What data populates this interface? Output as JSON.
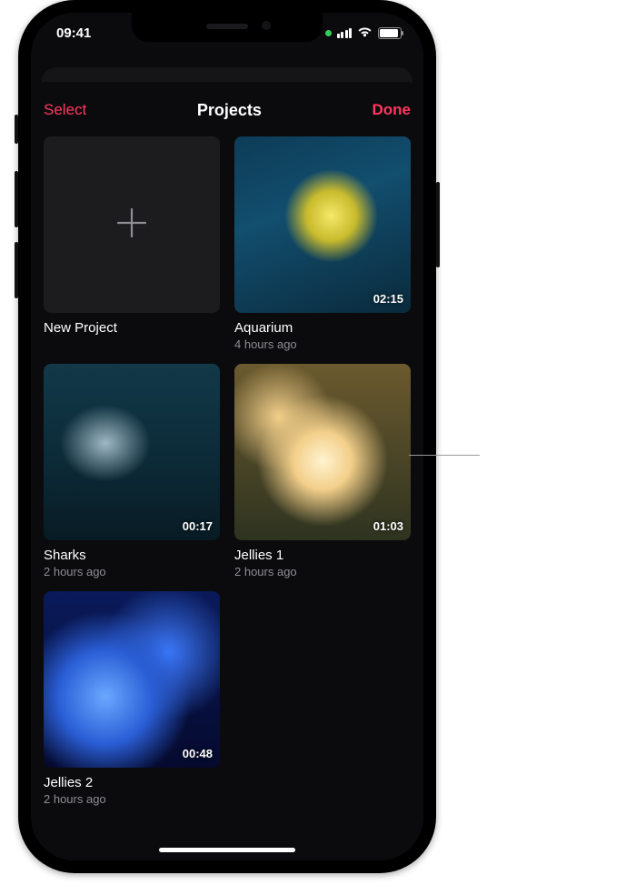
{
  "statusbar": {
    "time": "09:41"
  },
  "nav": {
    "select": "Select",
    "title": "Projects",
    "done": "Done"
  },
  "newProject": {
    "label": "New Project",
    "icon": "plus-icon"
  },
  "projects": [
    {
      "name": "Aquarium",
      "ago": "4 hours ago",
      "duration": "02:15",
      "imageClass": "img-aquarium"
    },
    {
      "name": "Sharks",
      "ago": "2 hours ago",
      "duration": "00:17",
      "imageClass": "img-sharks"
    },
    {
      "name": "Jellies 1",
      "ago": "2 hours ago",
      "duration": "01:03",
      "imageClass": "img-jellies1"
    },
    {
      "name": "Jellies 2",
      "ago": "2 hours ago",
      "duration": "00:48",
      "imageClass": "img-jellies2"
    }
  ],
  "colors": {
    "accent": "#ff375f",
    "bg": "#0b0b0d",
    "tile": "#1c1c1e",
    "muted": "#8e8e93"
  }
}
